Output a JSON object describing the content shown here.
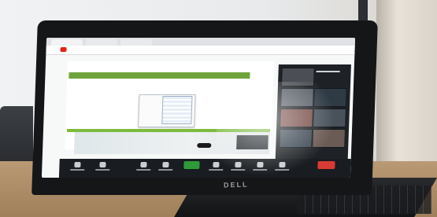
{
  "scene": {
    "description_type": "photo-of-laptop-screen",
    "laptop_brand": "DELL"
  },
  "colors": {
    "bezel": "#151618",
    "accent_green": "#6fa33b",
    "toolbar_dark": "#191c20",
    "share_green": "#2d9b3a",
    "end_red": "#d83b33",
    "table_wood": "#b99a75"
  },
  "icons": {
    "browser_logo": "youtube-logo-icon",
    "toolbar": [
      "mic-icon",
      "video-icon",
      "participants-icon",
      "share-icon",
      "record-icon",
      "reactions-icon",
      "apps-icon",
      "more-icon",
      "end-icon"
    ]
  }
}
